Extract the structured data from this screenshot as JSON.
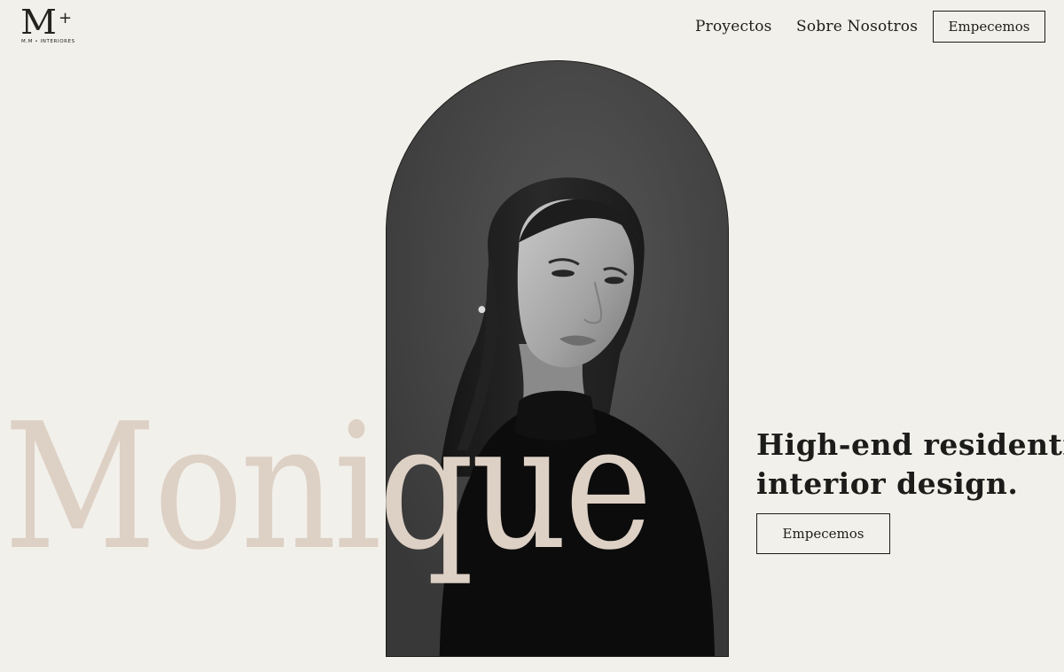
{
  "brand": {
    "logo_mark": "M",
    "logo_plus": "+",
    "logo_subtitle": "M.M • INTERIORES"
  },
  "nav": {
    "items": [
      {
        "label": "Proyectos"
      },
      {
        "label": "Sobre Nosotros"
      }
    ],
    "cta_label": "Empecemos"
  },
  "hero": {
    "big_word": "Monique",
    "headline_line1": "High-end residential",
    "headline_line2": "interior design.",
    "cta_label": "Empecemos",
    "portrait_subject": "portrait-photo"
  },
  "colors": {
    "background": "#f2f0ea",
    "text": "#1c1c1a",
    "accent_word": "#ddd0c5",
    "portrait_bg": "#3f3f3f"
  }
}
